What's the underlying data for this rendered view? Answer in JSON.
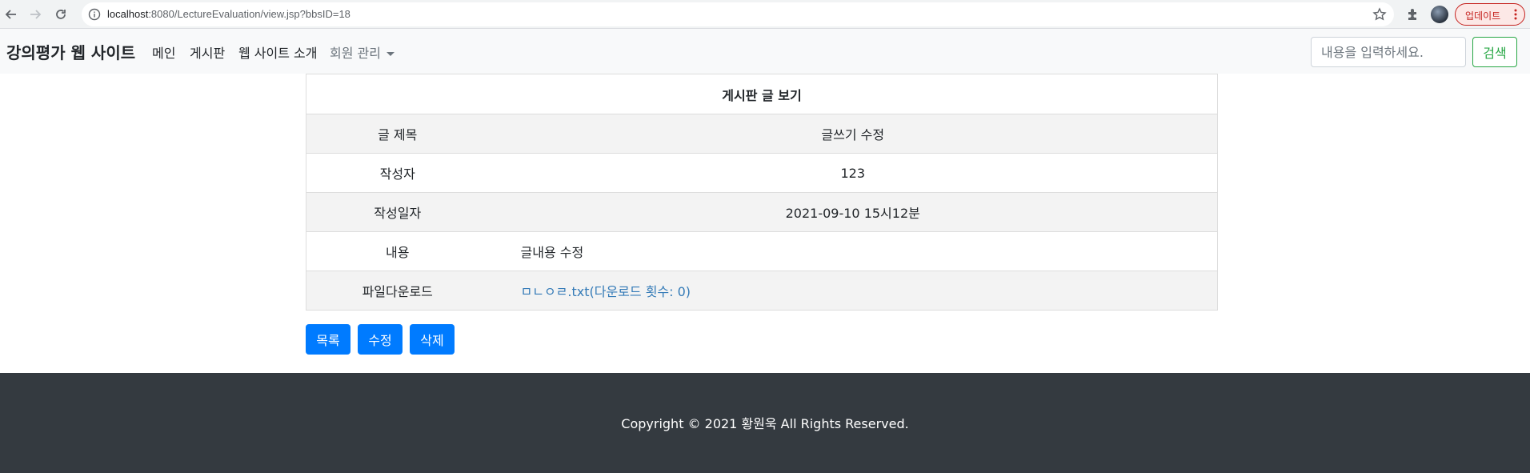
{
  "browser": {
    "url_host": "localhost",
    "url_rest": ":8080/LectureEvaluation/view.jsp?bbsID=18",
    "update_label": "업데이트"
  },
  "navbar": {
    "brand": "강의평가 웹 사이트",
    "links": [
      "메인",
      "게시판",
      "웹 사이트 소개"
    ],
    "dropdown_label": "회원 관리",
    "search_placeholder": "내용을 입력하세요.",
    "search_button": "검색"
  },
  "board": {
    "heading": "게시판 글 보기",
    "rows": [
      {
        "label": "글 제목",
        "value": "글쓰기 수정"
      },
      {
        "label": "작성자",
        "value": "123"
      },
      {
        "label": "작성일자",
        "value": "2021-09-10 15시12분"
      },
      {
        "label": "내용",
        "value": "글내용 수정"
      },
      {
        "label": "파일다운로드",
        "value": "ㅁㄴㅇㄹ.txt(다운로드 횟수: 0)"
      }
    ]
  },
  "actions": {
    "list": "목록",
    "edit": "수정",
    "delete": "삭제"
  },
  "footer": {
    "copyright": "Copyright © 2021 황원욱 All Rights Reserved."
  },
  "colors": {
    "primary": "#007bff",
    "success": "#28a745",
    "footer_bg": "#343a40",
    "link": "#337ab7"
  }
}
